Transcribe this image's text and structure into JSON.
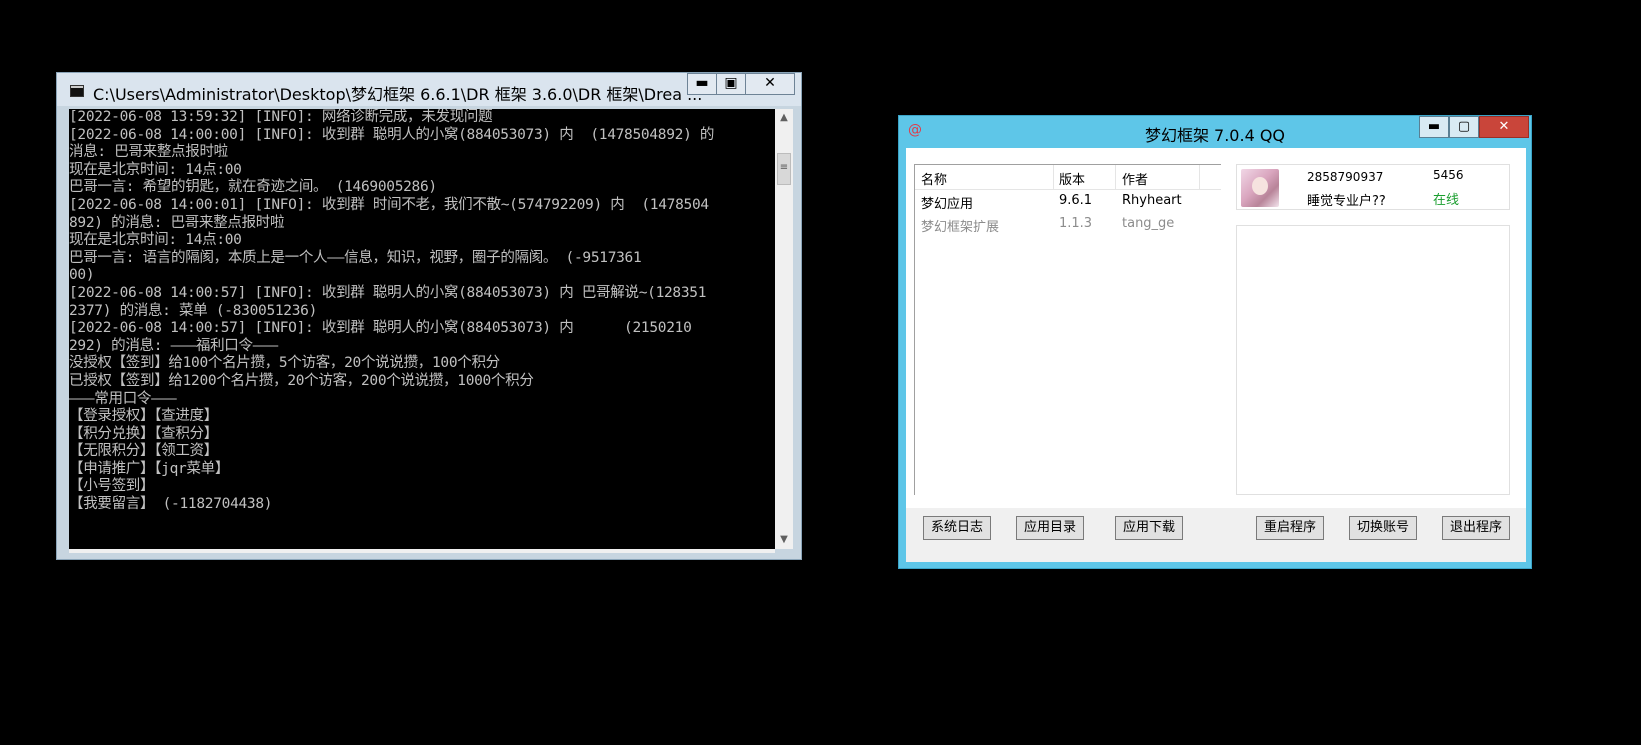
{
  "console": {
    "title": "C:\\Users\\Administrator\\Desktop\\梦幻框架 6.6.1\\DR 框架 3.6.0\\DR 框架\\Drea ...",
    "min_glyph": "▬",
    "max_glyph": "▣",
    "close_glyph": "✕",
    "lines": [
      "[2022-06-08 13:59:32] [INFO]: 网络诊断完成，未发现问题",
      "[2022-06-08 14:00:00] [INFO]: 收到群 聪明人的小窝(884053073) 内  (1478504892) 的",
      "消息: 巴哥来整点报时啦",
      "现在是北京时间: 14点:00",
      "巴哥一言: 希望的钥匙，就在奇迹之间。 (1469005286)",
      "[2022-06-08 14:00:01] [INFO]: 收到群 时间不老，我们不散~(574792209) 内  (1478504",
      "892) 的消息: 巴哥来整点报时啦",
      "现在是北京时间: 14点:00",
      "巴哥一言: 语言的隔阂，本质上是一个人——信息，知识，视野，圈子的隔阂。 (-9517361",
      "00)",
      "[2022-06-08 14:00:57] [INFO]: 收到群 聪明人的小窝(884053073) 内 巴哥解说~(128351",
      "2377) 的消息: 菜单 (-830051236)",
      "[2022-06-08 14:00:57] [INFO]: 收到群 聪明人的小窝(884053073) 内      (2150210",
      "292) 的消息: ———福利口令———",
      "没授权【签到】给100个名片攒，5个访客，20个说说攒，100个积分",
      "",
      "已授权【签到】给1200个名片攒，20个访客，200个说说攒，1000个积分",
      "———常用口令———",
      "【登录授权】【查进度】",
      "【积分兑换】【查积分】",
      "【无限积分】【领工资】",
      "【申请推广】【jqr菜单】",
      "【小号签到】",
      "【我要留言】 (-1182704438)"
    ],
    "scroll_up": "▲",
    "scroll_down": "▼",
    "scroll_thumb": "≡"
  },
  "qq": {
    "title": "梦幻框架 7.0.4 QQ",
    "icon_glyph": "@",
    "min_glyph": "▬",
    "max_glyph": "▢",
    "close_glyph": "✕",
    "columns": [
      "名称",
      "版本",
      "作者"
    ],
    "plugins": [
      {
        "name": "梦幻应用",
        "version": "9.6.1",
        "author": "Rhyheart"
      },
      {
        "name": "梦幻框架扩展",
        "version": "1.1.3",
        "author": "tang_ge"
      }
    ],
    "account": {
      "qq_number": "2858790937",
      "nickname": "睡觉专业户??",
      "count": "5456",
      "status": "在线"
    },
    "buttons": {
      "log": "系统日志",
      "app_dir": "应用目录",
      "app_download": "应用下载",
      "restart": "重启程序",
      "switch": "切换账号",
      "exit": "退出程序"
    }
  }
}
